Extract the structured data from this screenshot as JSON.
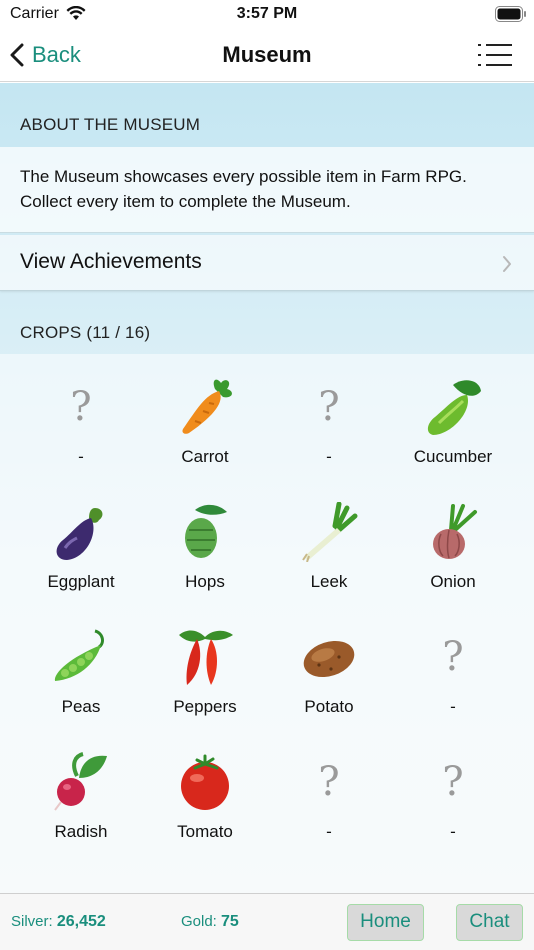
{
  "status": {
    "carrier": "Carrier",
    "time": "3:57 PM"
  },
  "nav": {
    "back_label": "Back",
    "title": "Museum"
  },
  "about": {
    "header": "ABOUT THE MUSEUM",
    "text": "The Museum showcases every possible item in Farm RPG. Collect every item to complete the Museum."
  },
  "achievements": {
    "label": "View Achievements"
  },
  "crops": {
    "header": "CROPS (11 / 16)",
    "items": [
      {
        "label": "-",
        "icon": "unknown-icon"
      },
      {
        "label": "Carrot",
        "icon": "carrot-icon"
      },
      {
        "label": "-",
        "icon": "unknown-icon"
      },
      {
        "label": "Cucumber",
        "icon": "cucumber-icon"
      },
      {
        "label": "Eggplant",
        "icon": "eggplant-icon"
      },
      {
        "label": "Hops",
        "icon": "hops-icon"
      },
      {
        "label": "Leek",
        "icon": "leek-icon"
      },
      {
        "label": "Onion",
        "icon": "onion-icon"
      },
      {
        "label": "Peas",
        "icon": "peas-icon"
      },
      {
        "label": "Peppers",
        "icon": "peppers-icon"
      },
      {
        "label": "Potato",
        "icon": "potato-icon"
      },
      {
        "label": "-",
        "icon": "unknown-icon"
      },
      {
        "label": "Radish",
        "icon": "radish-icon"
      },
      {
        "label": "Tomato",
        "icon": "tomato-icon"
      },
      {
        "label": "-",
        "icon": "unknown-icon"
      },
      {
        "label": "-",
        "icon": "unknown-icon"
      }
    ]
  },
  "unknown_mark": "?",
  "footer": {
    "silver_label": "Silver:",
    "silver_value": "26,452",
    "gold_label": "Gold:",
    "gold_value": "75",
    "home_label": "Home",
    "chat_label": "Chat"
  },
  "colors": {
    "accent": "#1a8e7d",
    "button_border": "#a6dba8"
  }
}
